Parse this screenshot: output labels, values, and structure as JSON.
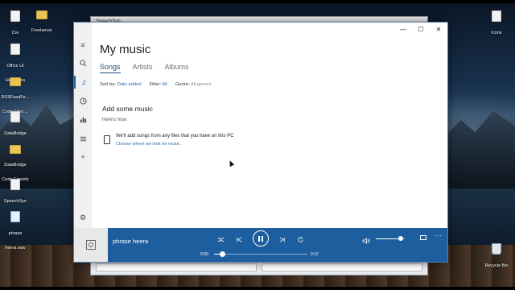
{
  "desktop": {
    "icons_left": [
      {
        "label": "Cre",
        "icon": "document-icon"
      },
      {
        "label": "Office UI\nHelp Files",
        "icon": "document-icon"
      },
      {
        "label": "RSSFeedFe...\nCode Files ...",
        "icon": "folder-icon"
      },
      {
        "label": "DataBridge\nDocs",
        "icon": "document-icon"
      },
      {
        "label": "DataBridge\nCode Exports",
        "icon": "folder-icon"
      },
      {
        "label": "SpeechSyn",
        "icon": "document-icon"
      },
      {
        "label": "phrase\nheera.wav",
        "icon": "media-file-icon"
      }
    ],
    "freelancer_label": "Freelancer",
    "icons_right": [
      {
        "label": "Icons",
        "icon": "document-icon"
      },
      {
        "label": "Recycle Bin",
        "icon": "recycle-bin-icon"
      }
    ]
  },
  "background_window": {
    "title": "SpeechSyn"
  },
  "window": {
    "controls": {
      "minimize": "—",
      "maximize": "☐",
      "close": "✕"
    }
  },
  "rail": [
    {
      "name": "hamburger-menu",
      "glyph": "≡"
    },
    {
      "name": "search",
      "glyph": "search-icon"
    },
    {
      "name": "music",
      "glyph": "♫"
    },
    {
      "name": "recent",
      "glyph": "clock-icon"
    },
    {
      "name": "now-playing",
      "glyph": "bars-icon"
    },
    {
      "name": "playlists",
      "glyph": "list-icon"
    },
    {
      "name": "new-playlist",
      "glyph": "+"
    },
    {
      "name": "settings",
      "glyph": "⚙"
    }
  ],
  "page": {
    "title": "My music",
    "tabs": [
      {
        "label": "Songs",
        "active": true
      },
      {
        "label": "Artists",
        "active": false
      },
      {
        "label": "Albums",
        "active": false
      }
    ],
    "filters": {
      "sort_label": "Sort by:",
      "sort_value": "Date added",
      "filter_label": "Filter:",
      "filter_value": "All",
      "genre_label": "Genre:",
      "genre_value": "All genres"
    },
    "add_heading": "Add some music",
    "howto": "Here's how:",
    "tip_text": "We'll add songs from any files that you have on this PC",
    "tip_link": "Choose where we look for music."
  },
  "player": {
    "track": "phrase heera",
    "time_elapsed": "0:00",
    "time_total": "0:12",
    "progress": 0.09,
    "volume": 0.85,
    "accent": "#1d5e9e"
  }
}
